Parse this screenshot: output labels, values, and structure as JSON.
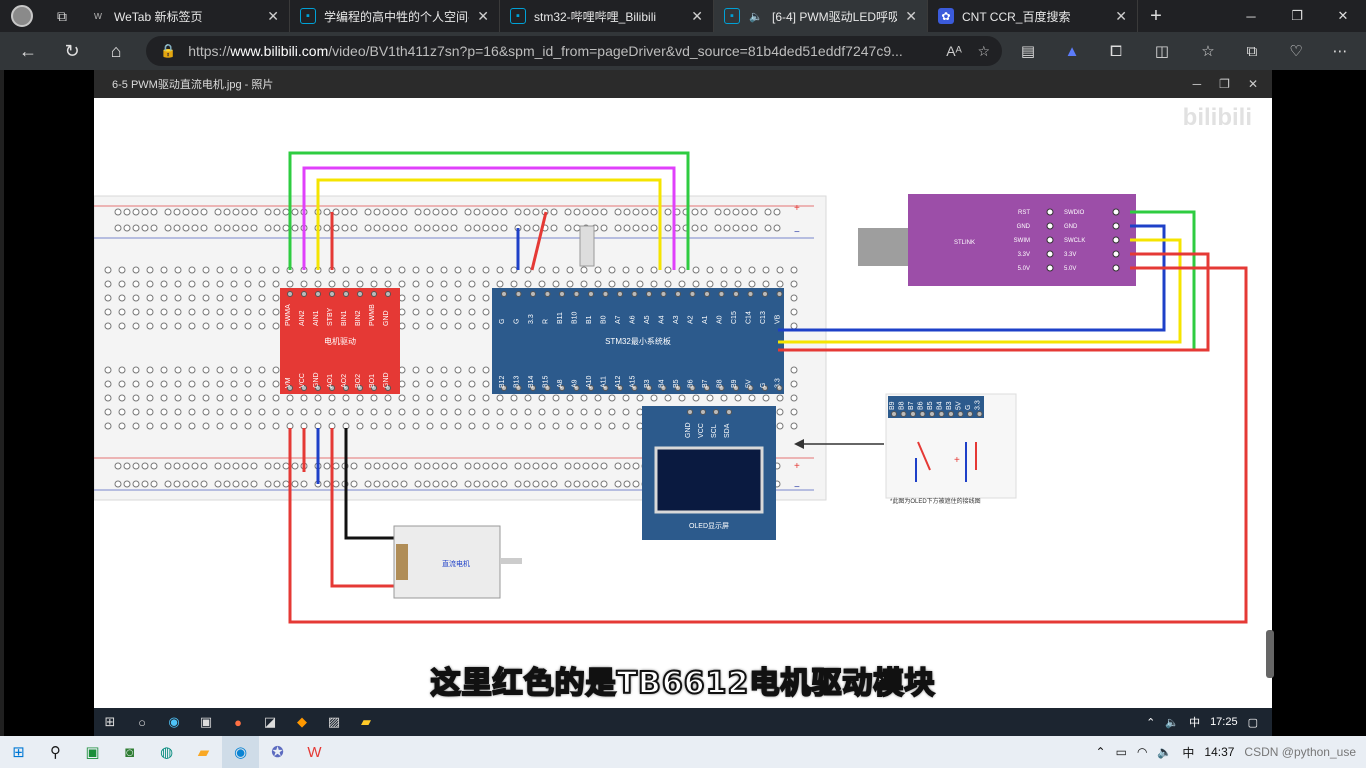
{
  "browser": {
    "tabs": [
      {
        "label": "WeTab 新标签页",
        "icon": "wetab-icon"
      },
      {
        "label": "学编程的高中牲的个人空间-",
        "icon": "bilibili-icon"
      },
      {
        "label": "stm32-哔哩哔哩_Bilibili",
        "icon": "bilibili-icon"
      },
      {
        "label": "[6-4] PWM驱动LED呼吸",
        "icon": "bilibili-icon"
      },
      {
        "label": "CNT CCR_百度搜索",
        "icon": "baidu-icon"
      }
    ],
    "url_prefix": "https://",
    "url_host": "www.bilibili.com",
    "url_path": "/video/BV1th411z7sn?p=16&spm_id_from=pageDriver&vd_source=81b4ded51eddf7247c9...",
    "read_aloud": "A",
    "accent": "#00a1d6"
  },
  "photo_viewer": {
    "title": "6-5 PWM驱动直流电机.jpg - 照片",
    "watermark": "bilibili"
  },
  "diagram": {
    "motor_driver_label": "电机驱动",
    "motor_driver_pins_top": [
      "PWMA",
      "AIN2",
      "AIN1",
      "STBY",
      "BIN1",
      "BIN2",
      "PWMB",
      "GND"
    ],
    "motor_driver_pins_bottom": [
      "VM",
      "VCC",
      "GND",
      "AO1",
      "AO2",
      "BO2",
      "BO1",
      "GND"
    ],
    "stm32_label": "STM32最小系统板",
    "stm32_pins_top": [
      "G",
      "G",
      "3.3",
      "R",
      "B11",
      "B10",
      "B1",
      "B0",
      "A7",
      "A6",
      "A5",
      "A4",
      "A3",
      "A2",
      "A1",
      "A0",
      "C15",
      "C14",
      "C13",
      "VB"
    ],
    "stm32_pins_bottom": [
      "B12",
      "B13",
      "B14",
      "B15",
      "A8",
      "A9",
      "A10",
      "A11",
      "A12",
      "A15",
      "B3",
      "B4",
      "B5",
      "B6",
      "B7",
      "B8",
      "B9",
      "5V",
      "G",
      "3.3"
    ],
    "stlink_label": "STLINK",
    "stlink_left_pins": [
      "RST",
      "GND",
      "SWIM",
      "3.3V",
      "5.0V"
    ],
    "stlink_right_pins": [
      "SWDIO",
      "GND",
      "SWCLK",
      "3.3V",
      "5.0V"
    ],
    "oled_pins": [
      "GND",
      "VCC",
      "SCL",
      "SDA"
    ],
    "oled_label": "OLED显示屏",
    "motor_label": "直流电机",
    "inset_note": "*此图为OLED下方被遮住的接线图",
    "inset_pins": [
      "B9",
      "B8",
      "B7",
      "B6",
      "B5",
      "B4",
      "B3",
      "5V",
      "G",
      "3.3"
    ]
  },
  "subtitle": "这里红色的是TB6612电机驱动模块",
  "inner_taskbar": {
    "time": "17:25",
    "ime": "中"
  },
  "taskbar": {
    "time": "14:37",
    "watermark": "CSDN @python_use",
    "ime": "中"
  }
}
